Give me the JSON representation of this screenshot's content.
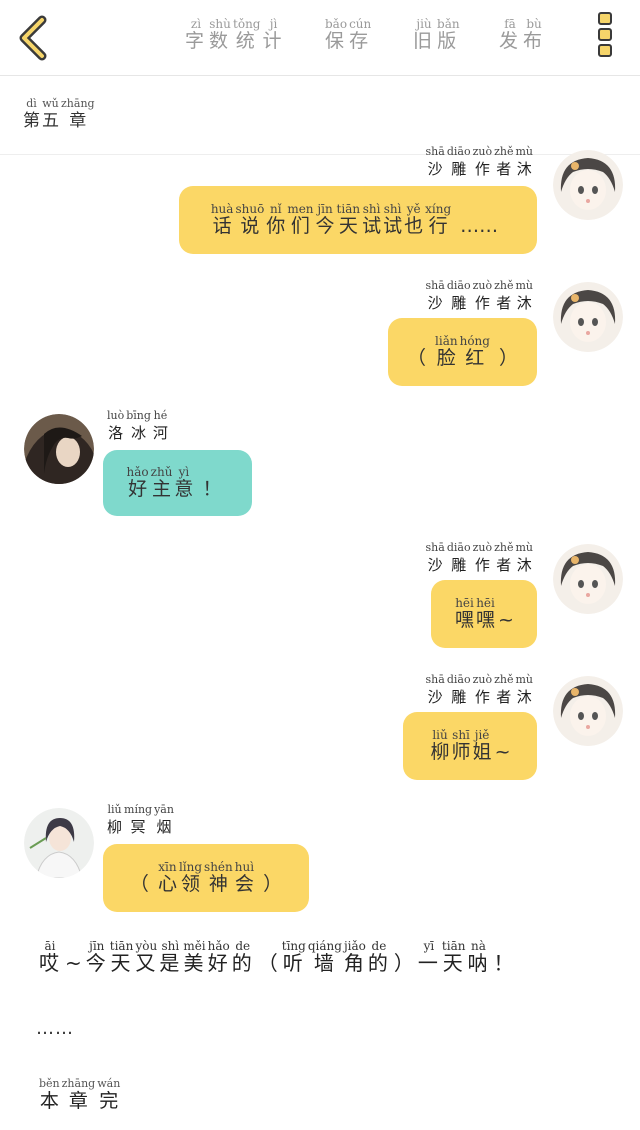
{
  "header": {
    "actions": [
      {
        "chars": [
          {
            "py": "zì",
            "hz": "字"
          },
          {
            "py": "shù",
            "hz": "数"
          },
          {
            "py": "tǒng",
            "hz": "统"
          },
          {
            "py": "jì",
            "hz": "计"
          }
        ]
      },
      {
        "chars": [
          {
            "py": "bǎo",
            "hz": "保"
          },
          {
            "py": "cún",
            "hz": "存"
          }
        ]
      },
      {
        "chars": [
          {
            "py": "jiù",
            "hz": "旧"
          },
          {
            "py": "bǎn",
            "hz": "版"
          }
        ]
      },
      {
        "chars": [
          {
            "py": "fā",
            "hz": "发"
          },
          {
            "py": "bù",
            "hz": "布"
          }
        ]
      }
    ]
  },
  "chapter": [
    {
      "py": "dì",
      "hz": "第"
    },
    {
      "py": "wǔ",
      "hz": "五"
    },
    {
      "py": "zhāng",
      "hz": "章"
    }
  ],
  "author_name": [
    {
      "py": "shā",
      "hz": "沙"
    },
    {
      "py": "diāo",
      "hz": "雕"
    },
    {
      "py": "zuò",
      "hz": "作"
    },
    {
      "py": "zhě",
      "hz": "者"
    },
    {
      "py": "mù",
      "hz": "沐"
    }
  ],
  "messages": [
    {
      "side": "right",
      "text": [
        {
          "py": "huà",
          "hz": "话"
        },
        {
          "py": "shuō",
          "hz": "说"
        },
        {
          "py": "nǐ",
          "hz": "你"
        },
        {
          "py": "men",
          "hz": "们"
        },
        {
          "py": "jīn",
          "hz": "今"
        },
        {
          "py": "tiān",
          "hz": "天"
        },
        {
          "py": "shì",
          "hz": "试"
        },
        {
          "py": "shì",
          "hz": "试"
        },
        {
          "py": "yě",
          "hz": "也"
        },
        {
          "py": "xíng",
          "hz": "行"
        }
      ],
      "tail": "……"
    },
    {
      "side": "right",
      "open": "（",
      "text": [
        {
          "py": "liǎn",
          "hz": "脸"
        },
        {
          "py": "hóng",
          "hz": "红"
        }
      ],
      "close": "）"
    },
    {
      "side": "left",
      "name": [
        {
          "py": "luò",
          "hz": "洛"
        },
        {
          "py": "bīng",
          "hz": "冰"
        },
        {
          "py": "hé",
          "hz": "河"
        }
      ],
      "text": [
        {
          "py": "hǎo",
          "hz": "好"
        },
        {
          "py": "zhǔ",
          "hz": "主"
        },
        {
          "py": "yì",
          "hz": "意"
        }
      ],
      "tail": "！"
    },
    {
      "side": "right",
      "text": [
        {
          "py": "hēi",
          "hz": "嘿"
        },
        {
          "py": "hēi",
          "hz": "嘿"
        }
      ],
      "tail": "~"
    },
    {
      "side": "right",
      "text": [
        {
          "py": "liǔ",
          "hz": "柳"
        },
        {
          "py": "shī",
          "hz": "师"
        },
        {
          "py": "jiě",
          "hz": "姐"
        }
      ],
      "tail": "~"
    },
    {
      "side": "left",
      "name": [
        {
          "py": "liǔ",
          "hz": "柳"
        },
        {
          "py": "míng",
          "hz": "冥"
        },
        {
          "py": "yān",
          "hz": "烟"
        }
      ],
      "open": "（",
      "text": [
        {
          "py": "xīn",
          "hz": "心"
        },
        {
          "py": "lǐng",
          "hz": "领"
        },
        {
          "py": "shén",
          "hz": "神"
        },
        {
          "py": "huì",
          "hz": "会"
        }
      ],
      "close": "）"
    }
  ],
  "narration": {
    "a": [
      {
        "py": "āi",
        "hz": "哎"
      }
    ],
    "tilde": "~",
    "b": [
      {
        "py": "jīn",
        "hz": "今"
      },
      {
        "py": "tiān",
        "hz": "天"
      },
      {
        "py": "yòu",
        "hz": "又"
      },
      {
        "py": "shì",
        "hz": "是"
      },
      {
        "py": "měi",
        "hz": "美"
      },
      {
        "py": "hǎo",
        "hz": "好"
      },
      {
        "py": "de",
        "hz": "的"
      }
    ],
    "open": "（",
    "c": [
      {
        "py": "tīng",
        "hz": "听"
      },
      {
        "py": "qiáng",
        "hz": "墙"
      },
      {
        "py": "jiǎo",
        "hz": "角"
      },
      {
        "py": "de",
        "hz": "的"
      }
    ],
    "close": "）",
    "d": [
      {
        "py": "yī",
        "hz": "一"
      },
      {
        "py": "tiān",
        "hz": "天"
      },
      {
        "py": "nà",
        "hz": "呐"
      }
    ],
    "bang": "！"
  },
  "ellipsis": "……",
  "end": [
    {
      "py": "běn",
      "hz": "本"
    },
    {
      "py": "zhāng",
      "hz": "章"
    },
    {
      "py": "wán",
      "hz": "完"
    }
  ]
}
